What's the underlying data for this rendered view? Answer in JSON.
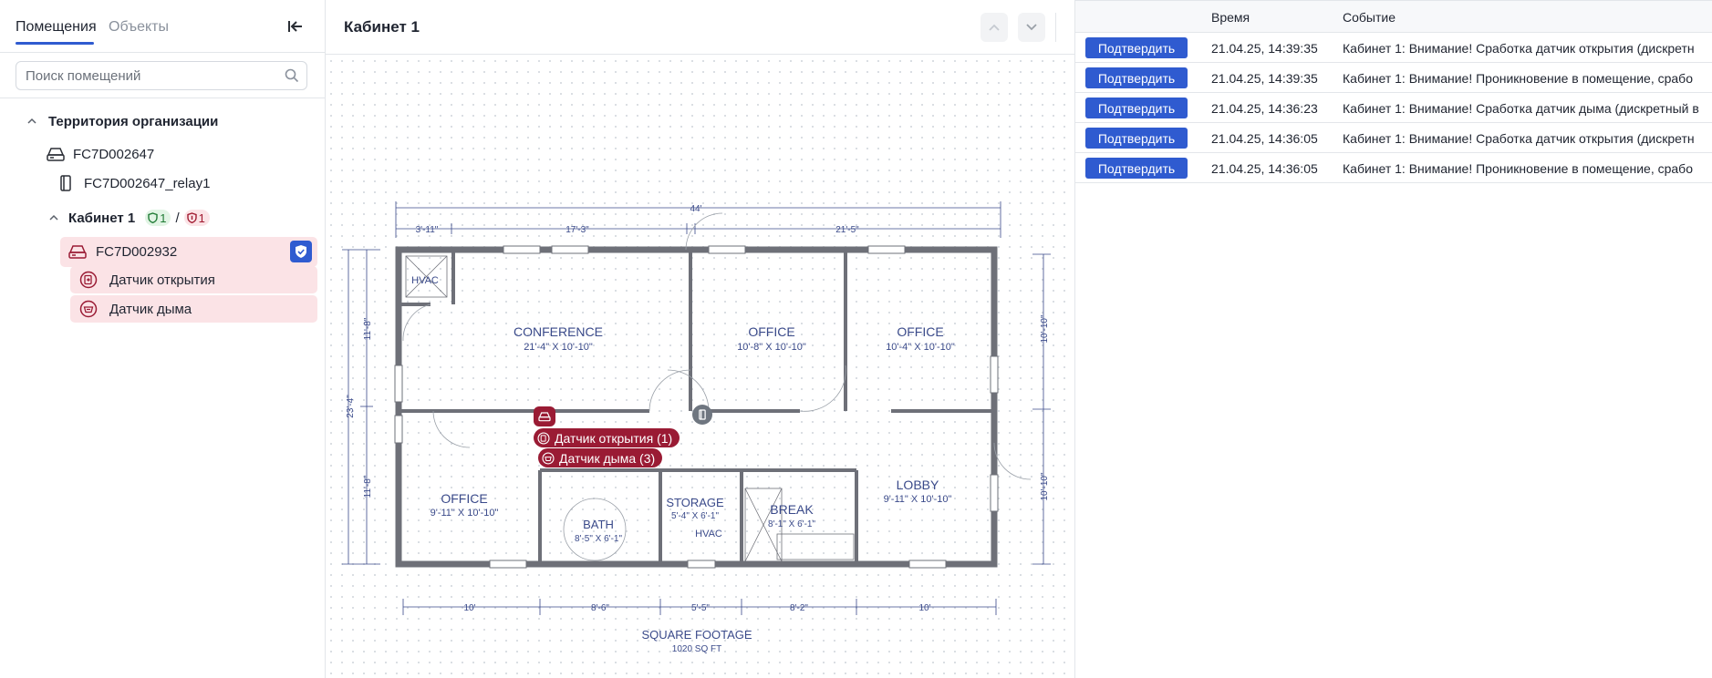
{
  "sidebar": {
    "tabs": [
      {
        "label": "Помещения",
        "active": true
      },
      {
        "label": "Объекты",
        "active": false
      }
    ],
    "search_placeholder": "Поиск помещений",
    "tree": {
      "territory": "Территория организации",
      "device1": "FC7D002647",
      "relay1": "FC7D002647_relay1",
      "room": "Кабинет 1",
      "room_badge_green": "1",
      "room_badge_sep": "/",
      "room_badge_red": "1",
      "device2": "FC7D002932",
      "sensor_open": "Датчик открытия",
      "sensor_smoke": "Датчик дыма"
    }
  },
  "center": {
    "title": "Кабинет 1",
    "markers": {
      "open_sensor": "Датчик открытия (1)",
      "smoke_sensor": "Датчик дыма (3)"
    },
    "plan": {
      "rooms": [
        {
          "name": "HVAC",
          "size": ""
        },
        {
          "name": "CONFERENCE",
          "size": "21'-4\" X 10'-10\""
        },
        {
          "name": "OFFICE",
          "size": "10'-8\" X 10'-10\""
        },
        {
          "name": "OFFICE",
          "size": "10'-4\" X 10'-10\""
        },
        {
          "name": "OFFICE",
          "size": "9'-11\" X 10'-10\""
        },
        {
          "name": "BATH",
          "size": "8'-5\" X 6'-1\""
        },
        {
          "name": "STORAGE",
          "size": "5'-4\" X 6'-1\""
        },
        {
          "name": "BREAK",
          "size": "8'-1\" X 6'-1\""
        },
        {
          "name": "LOBBY",
          "size": "9'-11\" X 10'-10\""
        },
        {
          "name": "HVAC",
          "size": ""
        }
      ],
      "dims_top": [
        "44'",
        "3'-11\"",
        "17'-3\"",
        "21'-5\""
      ],
      "dims_bottom": [
        "10'",
        "8'-6\"",
        "5'-5\"",
        "8'-2\"",
        "10'"
      ],
      "dims_left": [
        "23'-4\"",
        "11'-8\"",
        "11'-8\""
      ],
      "dims_right": [
        "10'-10\"",
        "10'-10\""
      ],
      "footage_title": "SQUARE FOOTAGE",
      "footage_value": "1020 SQ FT"
    }
  },
  "events": {
    "columns": {
      "time": "Время",
      "event": "Событие"
    },
    "confirm_label": "Подтвердить",
    "rows": [
      {
        "time": "21.04.25, 14:39:35",
        "text": "Кабинет 1: Внимание! Сработка датчик открытия (дискретн"
      },
      {
        "time": "21.04.25, 14:39:35",
        "text": "Кабинет 1: Внимание! Проникновение в помещение, срабо"
      },
      {
        "time": "21.04.25, 14:36:23",
        "text": "Кабинет 1: Внимание! Сработка датчик дыма (дискретный в"
      },
      {
        "time": "21.04.25, 14:36:05",
        "text": "Кабинет 1: Внимание! Сработка датчик открытия (дискретн"
      },
      {
        "time": "21.04.25, 14:36:05",
        "text": "Кабинет 1: Внимание! Проникновение в помещение, срабо"
      }
    ]
  },
  "colors": {
    "accent": "#2f5bd0",
    "alarm": "#9a1b34",
    "alarm_bg": "#fbe3e6",
    "ok_bg": "#e1f4e4",
    "ok_text": "#1e7a33",
    "blueprint": "#3a4a8a"
  },
  "icons": {
    "collapse": "collapse-left-icon",
    "search": "search-icon",
    "device": "hub-icon",
    "relay": "relay-icon",
    "open_sensor": "door-sensor-icon",
    "smoke_sensor": "smoke-sensor-icon",
    "shield": "shield-icon"
  }
}
